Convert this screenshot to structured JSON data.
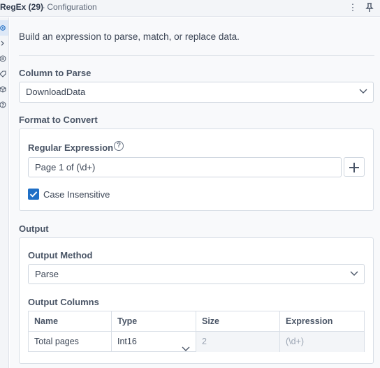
{
  "window": {
    "tool_name": "RegEx (29)",
    "subtitle": "- Configuration",
    "menu_icon": "more-vertical-icon",
    "pin_icon": "pin-icon"
  },
  "rail_icons": [
    "settings-gear-icon",
    "code-brackets-icon",
    "connections-icon",
    "tag-icon",
    "package-icon",
    "help-circle-icon"
  ],
  "intro_text": "Build an expression to parse, match, or replace data.",
  "column_to_parse": {
    "label": "Column to Parse",
    "value": "DownloadData"
  },
  "format_to_convert": {
    "label": "Format to Convert",
    "regex_label": "Regular Expression",
    "regex_value": "Page 1 of (\\d+)",
    "help_glyph": "?",
    "case_insensitive_label": "Case Insensitive",
    "case_insensitive_checked": true
  },
  "output": {
    "label": "Output",
    "method_label": "Output Method",
    "method_value": "Parse",
    "columns_label": "Output Columns",
    "columns_headers": [
      "Name",
      "Type",
      "Size",
      "Expression"
    ],
    "rows": [
      {
        "name": "Total pages",
        "type": "Int16",
        "size": "2",
        "expression": "(\\d+)"
      }
    ]
  },
  "colors": {
    "accent": "#1f6fc6",
    "panel_border": "#d8dee6",
    "background": "#f8f9fb"
  }
}
